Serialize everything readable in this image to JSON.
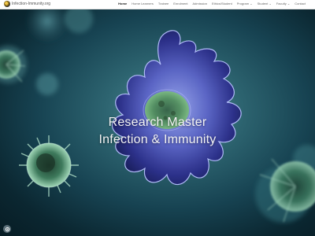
{
  "site": {
    "title": "Infection-Immunity.org"
  },
  "nav": {
    "items": [
      {
        "label": "Home",
        "active": true
      },
      {
        "label": "Home Learners"
      },
      {
        "label": "Trainee"
      },
      {
        "label": "Enrolment"
      },
      {
        "label": "Admission"
      },
      {
        "label": "Ethics/Student"
      },
      {
        "label": "Program ⌄"
      },
      {
        "label": "Student ⌄"
      },
      {
        "label": "Faculty ⌄"
      },
      {
        "label": "Contact"
      }
    ]
  },
  "hero": {
    "line1": "Research Master",
    "line2": "Infection & Immunity"
  },
  "colors": {
    "accent": "#3f4fb8",
    "background": "#0f3340"
  },
  "icons": {
    "logo": "university-seal",
    "corner": "gear-icon"
  }
}
